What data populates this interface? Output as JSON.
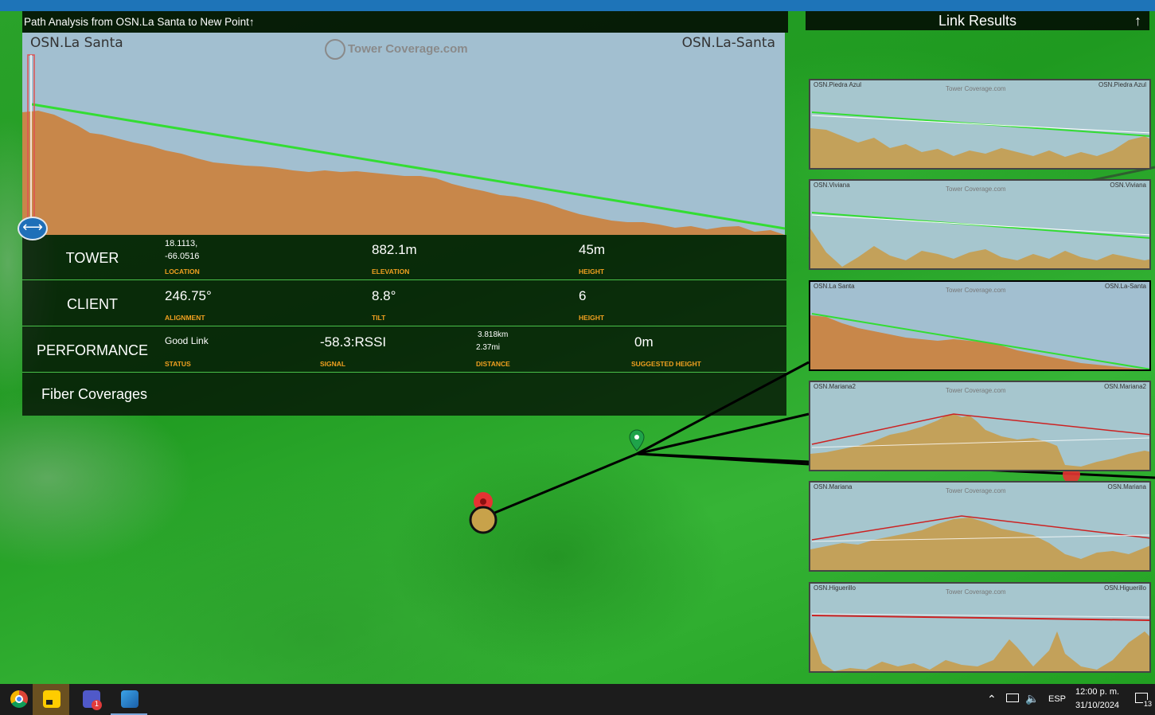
{
  "path_panel": {
    "title": "Path Analysis from OSN.La Santa  to New Point",
    "title_arrow": "↑",
    "left_site": "OSN.La Santa",
    "right_site": "OSN.La-Santa",
    "watermark": "Tower Coverage.com",
    "handle_icon": "⟷"
  },
  "tower": {
    "title": "TOWER",
    "location_value_1": "18.1113,",
    "location_value_2": "-66.0516",
    "location_label": "LOCATION",
    "elevation_value": "882.1m",
    "elevation_label": "ELEVATION",
    "height_value": "45m",
    "height_label": "HEIGHT"
  },
  "client": {
    "title": "CLIENT",
    "alignment_value": "246.75°",
    "alignment_label": "ALIGNMENT",
    "tilt_value": "8.8°",
    "tilt_label": "TILT",
    "height_value": "6",
    "height_label": "HEIGHT"
  },
  "performance": {
    "title": "PERFORMANCE",
    "status_value": "Good Link",
    "status_label": "STATUS",
    "signal_value": "-58.3:RSSI",
    "signal_label": "SIGNAL",
    "distance_km": "3.818km",
    "distance_mi": "2.37mi",
    "distance_label": "DISTANCE",
    "suggested_value": "0m",
    "suggested_label": "SUGGESTED HEIGHT"
  },
  "fiber": {
    "label": "Fiber Coverages"
  },
  "link_results": {
    "title": "Link Results",
    "arrow": "↑",
    "watermark": "Tower Coverage.com",
    "cards": [
      {
        "left": "OSN.Piedra Azul",
        "right": "OSN.Piedra Azul",
        "line": "green"
      },
      {
        "left": "OSN.Viviana",
        "right": "OSN.Viviana",
        "line": "green"
      },
      {
        "left": "OSN.La Santa",
        "right": "OSN.La-Santa",
        "line": "green"
      },
      {
        "left": "OSN.Mariana2",
        "right": "OSN.Mariana2",
        "line": "red"
      },
      {
        "left": "OSN.Mariana",
        "right": "OSN.Mariana",
        "line": "red"
      },
      {
        "left": "OSN.Higuerillo",
        "right": "OSN.Higuerillo",
        "line": "red"
      }
    ]
  },
  "taskbar": {
    "apps": [
      "chrome-icon",
      "sticky-notes-icon",
      "teams-icon",
      "photos-icon"
    ],
    "teams_badge": "1",
    "language": "ESP",
    "time": "12:00 p. m.",
    "date": "31/10/2024",
    "notification_count": "13"
  },
  "colors": {
    "terrain": "#c8874a",
    "sky": "#a2bfd0",
    "link_ok": "#33dd33",
    "link_bad": "#cc2222",
    "label": "#f0a020"
  }
}
